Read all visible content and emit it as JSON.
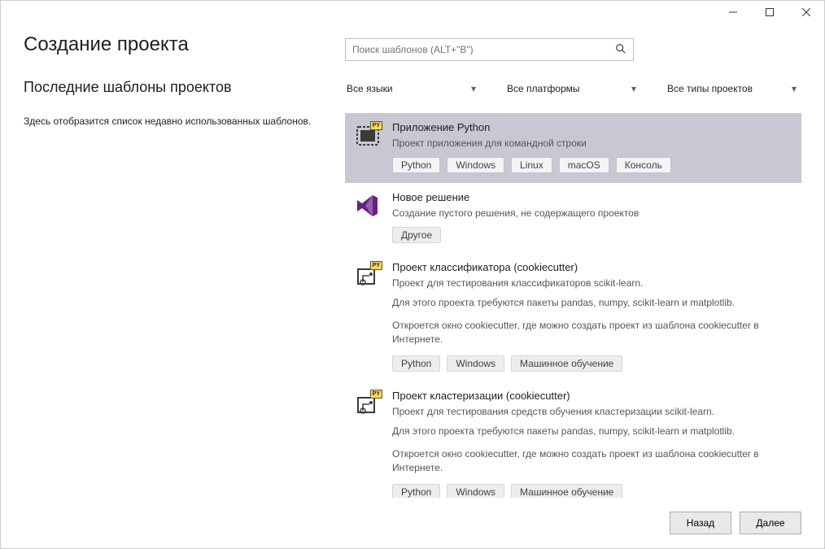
{
  "window": {
    "minimize": "–",
    "maximize": "□",
    "close": "✕"
  },
  "page": {
    "title": "Создание проекта",
    "recent_heading": "Последние шаблоны проектов",
    "recent_empty": "Здесь отобразится список недавно использованных шаблонов."
  },
  "search": {
    "placeholder": "Поиск шаблонов (ALT+\"B\")"
  },
  "filters": {
    "language": "Все языки",
    "platform": "Все платформы",
    "project_type": "Все типы проектов"
  },
  "templates": [
    {
      "title": "Приложение Python",
      "desc": "Проект приложения для командной строки",
      "tags": [
        "Python",
        "Windows",
        "Linux",
        "macOS",
        "Консоль"
      ],
      "selected": true,
      "icon": "python-app"
    },
    {
      "title": "Новое решение",
      "desc": "Создание пустого решения, не содержащего проектов",
      "tags": [
        "Другое"
      ],
      "selected": false,
      "icon": "vs-solution"
    },
    {
      "title": "Проект классификатора (cookiecutter)",
      "desc": "Проект для тестирования классификаторов scikit-learn.",
      "paragraphs": [
        "Для этого проекта требуются пакеты pandas, numpy, scikit-learn и matplotlib.",
        "Откроется окно cookiecutter, где можно создать проект из шаблона cookiecutter в Интернете."
      ],
      "tags": [
        "Python",
        "Windows",
        "Машинное обучение"
      ],
      "selected": false,
      "icon": "python-ml"
    },
    {
      "title": "Проект кластеризации (cookiecutter)",
      "desc": "Проект для тестирования средств обучения кластеризации scikit-learn.",
      "paragraphs": [
        "Для этого проекта требуются пакеты pandas, numpy, scikit-learn и matplotlib.",
        "Откроется окно cookiecutter, где можно создать проект из шаблона cookiecutter в Интернете."
      ],
      "tags": [
        "Python",
        "Windows",
        "Машинное обучение"
      ],
      "selected": false,
      "icon": "python-ml"
    }
  ],
  "footer": {
    "back": "Назад",
    "next": "Далее"
  }
}
